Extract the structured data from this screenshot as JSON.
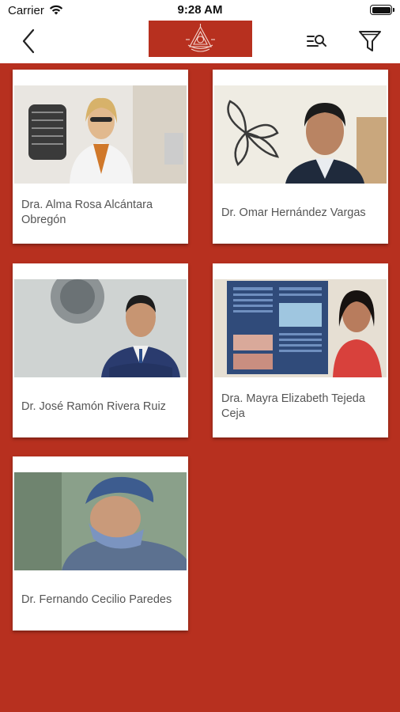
{
  "status_bar": {
    "carrier": "Carrier",
    "time": "9:28 AM"
  },
  "nav": {
    "back_icon": "chevron-left-icon",
    "logo": "organization-logo",
    "search_list_icon": "search-list-icon",
    "filter_icon": "filter-icon"
  },
  "colors": {
    "brand": "#b7301f",
    "card_text": "#555555",
    "background": "#b7301f"
  },
  "doctors": [
    {
      "name": "Dra. Alma Rosa Alcántara Obregón",
      "photo": "doctor-portrait-photo"
    },
    {
      "name": "Dr. Omar Hernández Vargas",
      "photo": "doctor-portrait-photo"
    },
    {
      "name": "Dr. José Ramón Rivera Ruiz",
      "photo": "doctor-portrait-photo"
    },
    {
      "name": "Dra. Mayra Elizabeth Tejeda Ceja",
      "photo": "doctor-portrait-photo"
    },
    {
      "name": "Dr. Fernando Cecilio Paredes",
      "photo": "doctor-surgery-photo"
    }
  ]
}
